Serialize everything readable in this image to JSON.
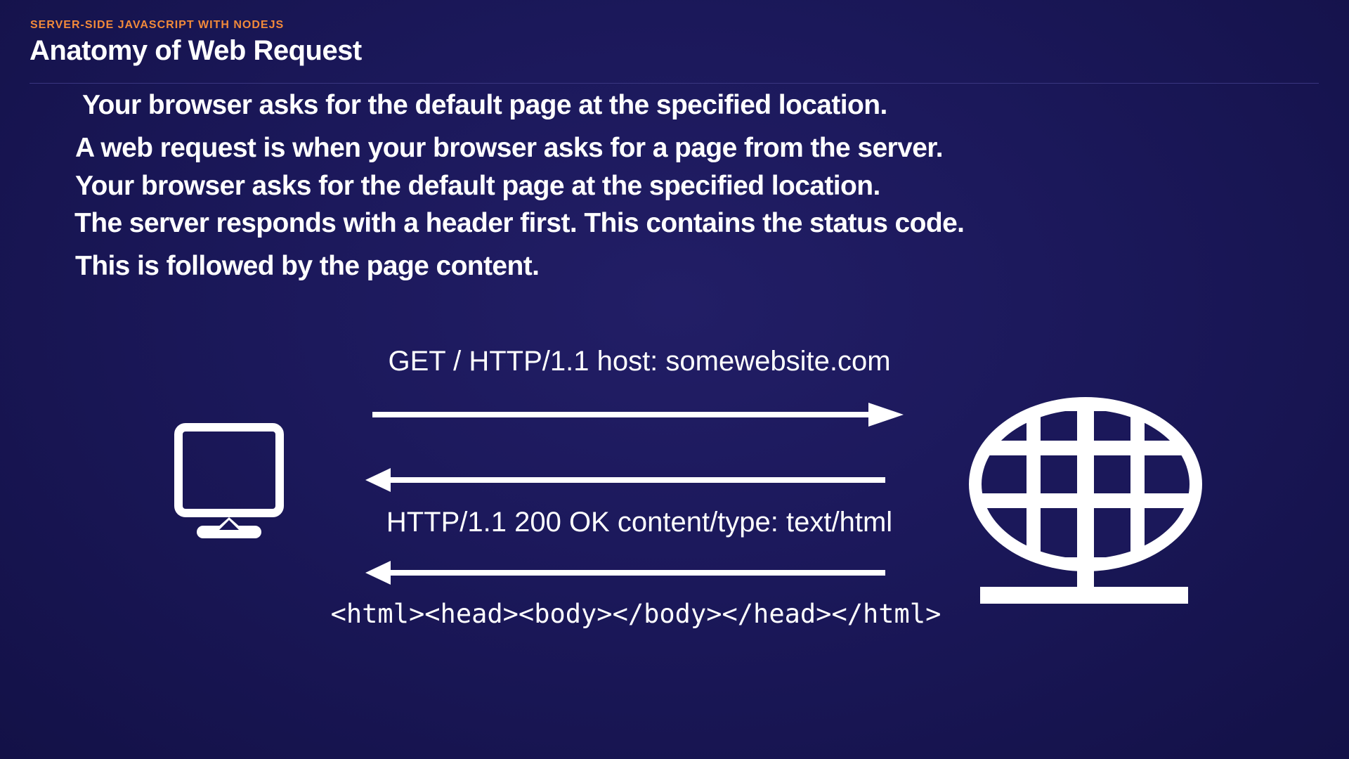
{
  "header": {
    "kicker": "SERVER-SIDE JAVASCRIPT WITH NODEJS",
    "title": "Anatomy of Web Request"
  },
  "bullets": [
    "Your browser asks for the default page at the specified location.",
    "A web request is when your browser asks for a page from the server.",
    "Your browser asks for the default page at the specified location.",
    "The server responds with a header first. This contains the status code.",
    "This is followed by the page content."
  ],
  "diagram": {
    "request_label": "GET  /  HTTP/1.1  host: somewebsite.com",
    "response_header_label": "HTTP/1.1  200  OK  content/type: text/html",
    "response_body_label": "<html><head><body></body></head></html>",
    "client_icon": "monitor-icon",
    "server_icon": "globe-icon",
    "colors": {
      "foreground": "#ffffff",
      "accent": "#f28a3a",
      "background": "#1b185a"
    }
  }
}
